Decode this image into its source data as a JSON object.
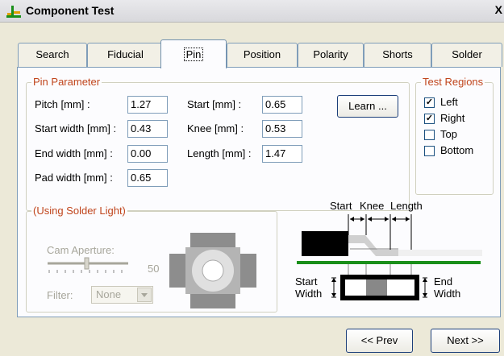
{
  "window": {
    "title": "Component Test",
    "close_glyph": "X"
  },
  "tabs": [
    {
      "label": "Search"
    },
    {
      "label": "Fiducial"
    },
    {
      "label": "Pin",
      "active": true
    },
    {
      "label": "Position"
    },
    {
      "label": "Polarity"
    },
    {
      "label": "Shorts"
    },
    {
      "label": "Solder"
    }
  ],
  "pin_parameter": {
    "legend": "Pin Parameter",
    "pitch": {
      "label": "Pitch [mm] :",
      "value": "1.27"
    },
    "start_width": {
      "label": "Start width [mm] :",
      "value": "0.43"
    },
    "end_width": {
      "label": "End width [mm] :",
      "value": "0.00"
    },
    "pad_width": {
      "label": "Pad width [mm] :",
      "value": "0.65"
    },
    "start": {
      "label": "Start [mm] :",
      "value": "0.65"
    },
    "knee": {
      "label": "Knee [mm] :",
      "value": "0.53"
    },
    "length": {
      "label": "Length [mm] :",
      "value": "1.47"
    },
    "learn_button": "Learn ..."
  },
  "test_regions": {
    "legend": "Test Regions",
    "items": [
      {
        "label": "Left",
        "checked": true
      },
      {
        "label": "Right",
        "checked": true
      },
      {
        "label": "Top",
        "checked": false
      },
      {
        "label": "Bottom",
        "checked": false
      }
    ]
  },
  "solder_light": {
    "legend": "(Using Solder Light)",
    "cam_aperture_label": "Cam Aperture:",
    "cam_aperture_value": "50",
    "filter_label": "Filter:",
    "filter_value": "None"
  },
  "diagram": {
    "start": "Start",
    "knee": "Knee",
    "length": "Length",
    "start_width_line1": "Start",
    "start_width_line2": "Width",
    "end_width_line1": "End",
    "end_width_line2": "Width"
  },
  "nav": {
    "prev": "<< Prev",
    "next": "Next >>"
  },
  "colors": {
    "accent_label": "#c0451c",
    "board_green": "#1a8f1a"
  }
}
